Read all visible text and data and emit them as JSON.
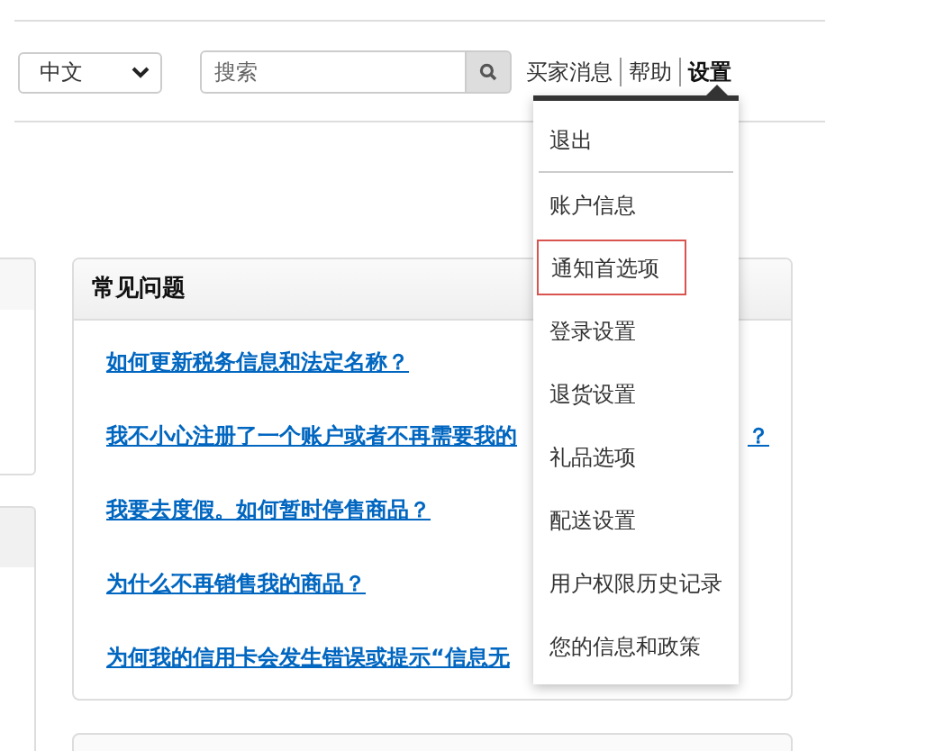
{
  "header": {
    "language_select": {
      "value": "中文"
    },
    "search": {
      "placeholder": "搜索"
    },
    "links": [
      {
        "label": "买家消息",
        "selected": false
      },
      {
        "label": "帮助",
        "selected": false
      },
      {
        "label": "设置",
        "selected": true
      }
    ]
  },
  "faq_card": {
    "title": "常见问题",
    "links": [
      {
        "text": "如何更新税务信息和法定名称？"
      },
      {
        "text": "我不小心注册了一个账户或者不再需要我的",
        "tail": "？"
      },
      {
        "text": "我要去度假。如何暂时停售商品？"
      },
      {
        "text": "为什么不再销售我的商品？"
      },
      {
        "text": "为何我的信用卡会发生错误或提示“信息无"
      }
    ]
  },
  "settings_menu": {
    "items": [
      {
        "label": "退出",
        "selected": false,
        "divider_after": true
      },
      {
        "label": "账户信息",
        "selected": false
      },
      {
        "label": "通知首选项",
        "selected": true
      },
      {
        "label": "登录设置",
        "selected": false
      },
      {
        "label": "退货设置",
        "selected": false
      },
      {
        "label": "礼品选项",
        "selected": false
      },
      {
        "label": "配送设置",
        "selected": false
      },
      {
        "label": "用户权限历史记录",
        "selected": false
      },
      {
        "label": "您的信息和政策",
        "selected": false
      }
    ]
  }
}
